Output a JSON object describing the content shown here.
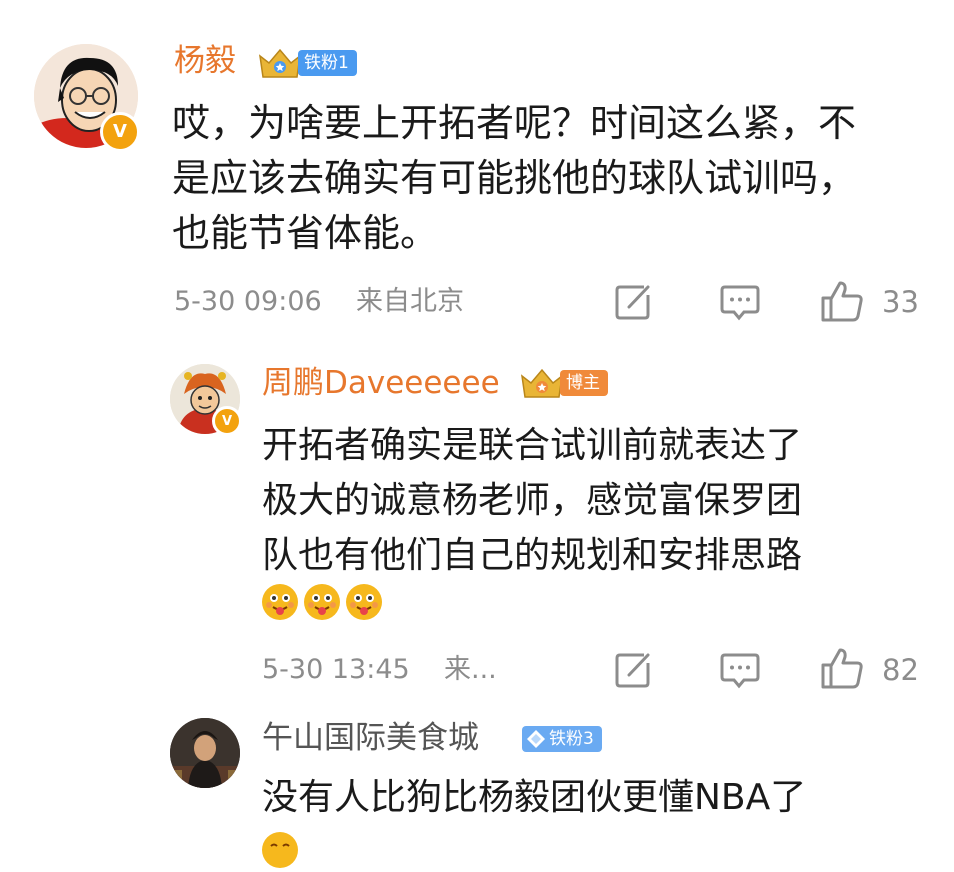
{
  "comments": [
    {
      "author": "杨毅",
      "badge": "铁粉1",
      "lines": [
        "哎，为啥要上开拓者呢？时间这么紧，不",
        "是应该去确实有可能挑他的球队试训吗，",
        "也能节省体能。"
      ],
      "time": "5-30 09:06",
      "location": "来自北京",
      "likes": "33"
    },
    {
      "author": "周鹏Daveeeeee",
      "badge": "博主",
      "lines": [
        "开拓者确实是联合试训前就表达了",
        "极大的诚意杨老师，感觉富保罗团",
        "队也有他们自己的规划和安排思路"
      ],
      "time": "5-30 13:45",
      "location": "来...",
      "likes": "82"
    },
    {
      "author": "午山国际美食城",
      "badge": "铁粉3",
      "lines": [
        "没有人比狗比杨毅团伙更懂NBA了"
      ]
    }
  ],
  "verified_mark": "V",
  "colors": {
    "name_orange": "#e7772d",
    "badge_blue": "#4a9af0",
    "badge_orange": "#f08a3a",
    "badge_light_blue": "#6aaaf2",
    "gold": "#e9b536",
    "meta_gray": "#8c8c8c"
  }
}
